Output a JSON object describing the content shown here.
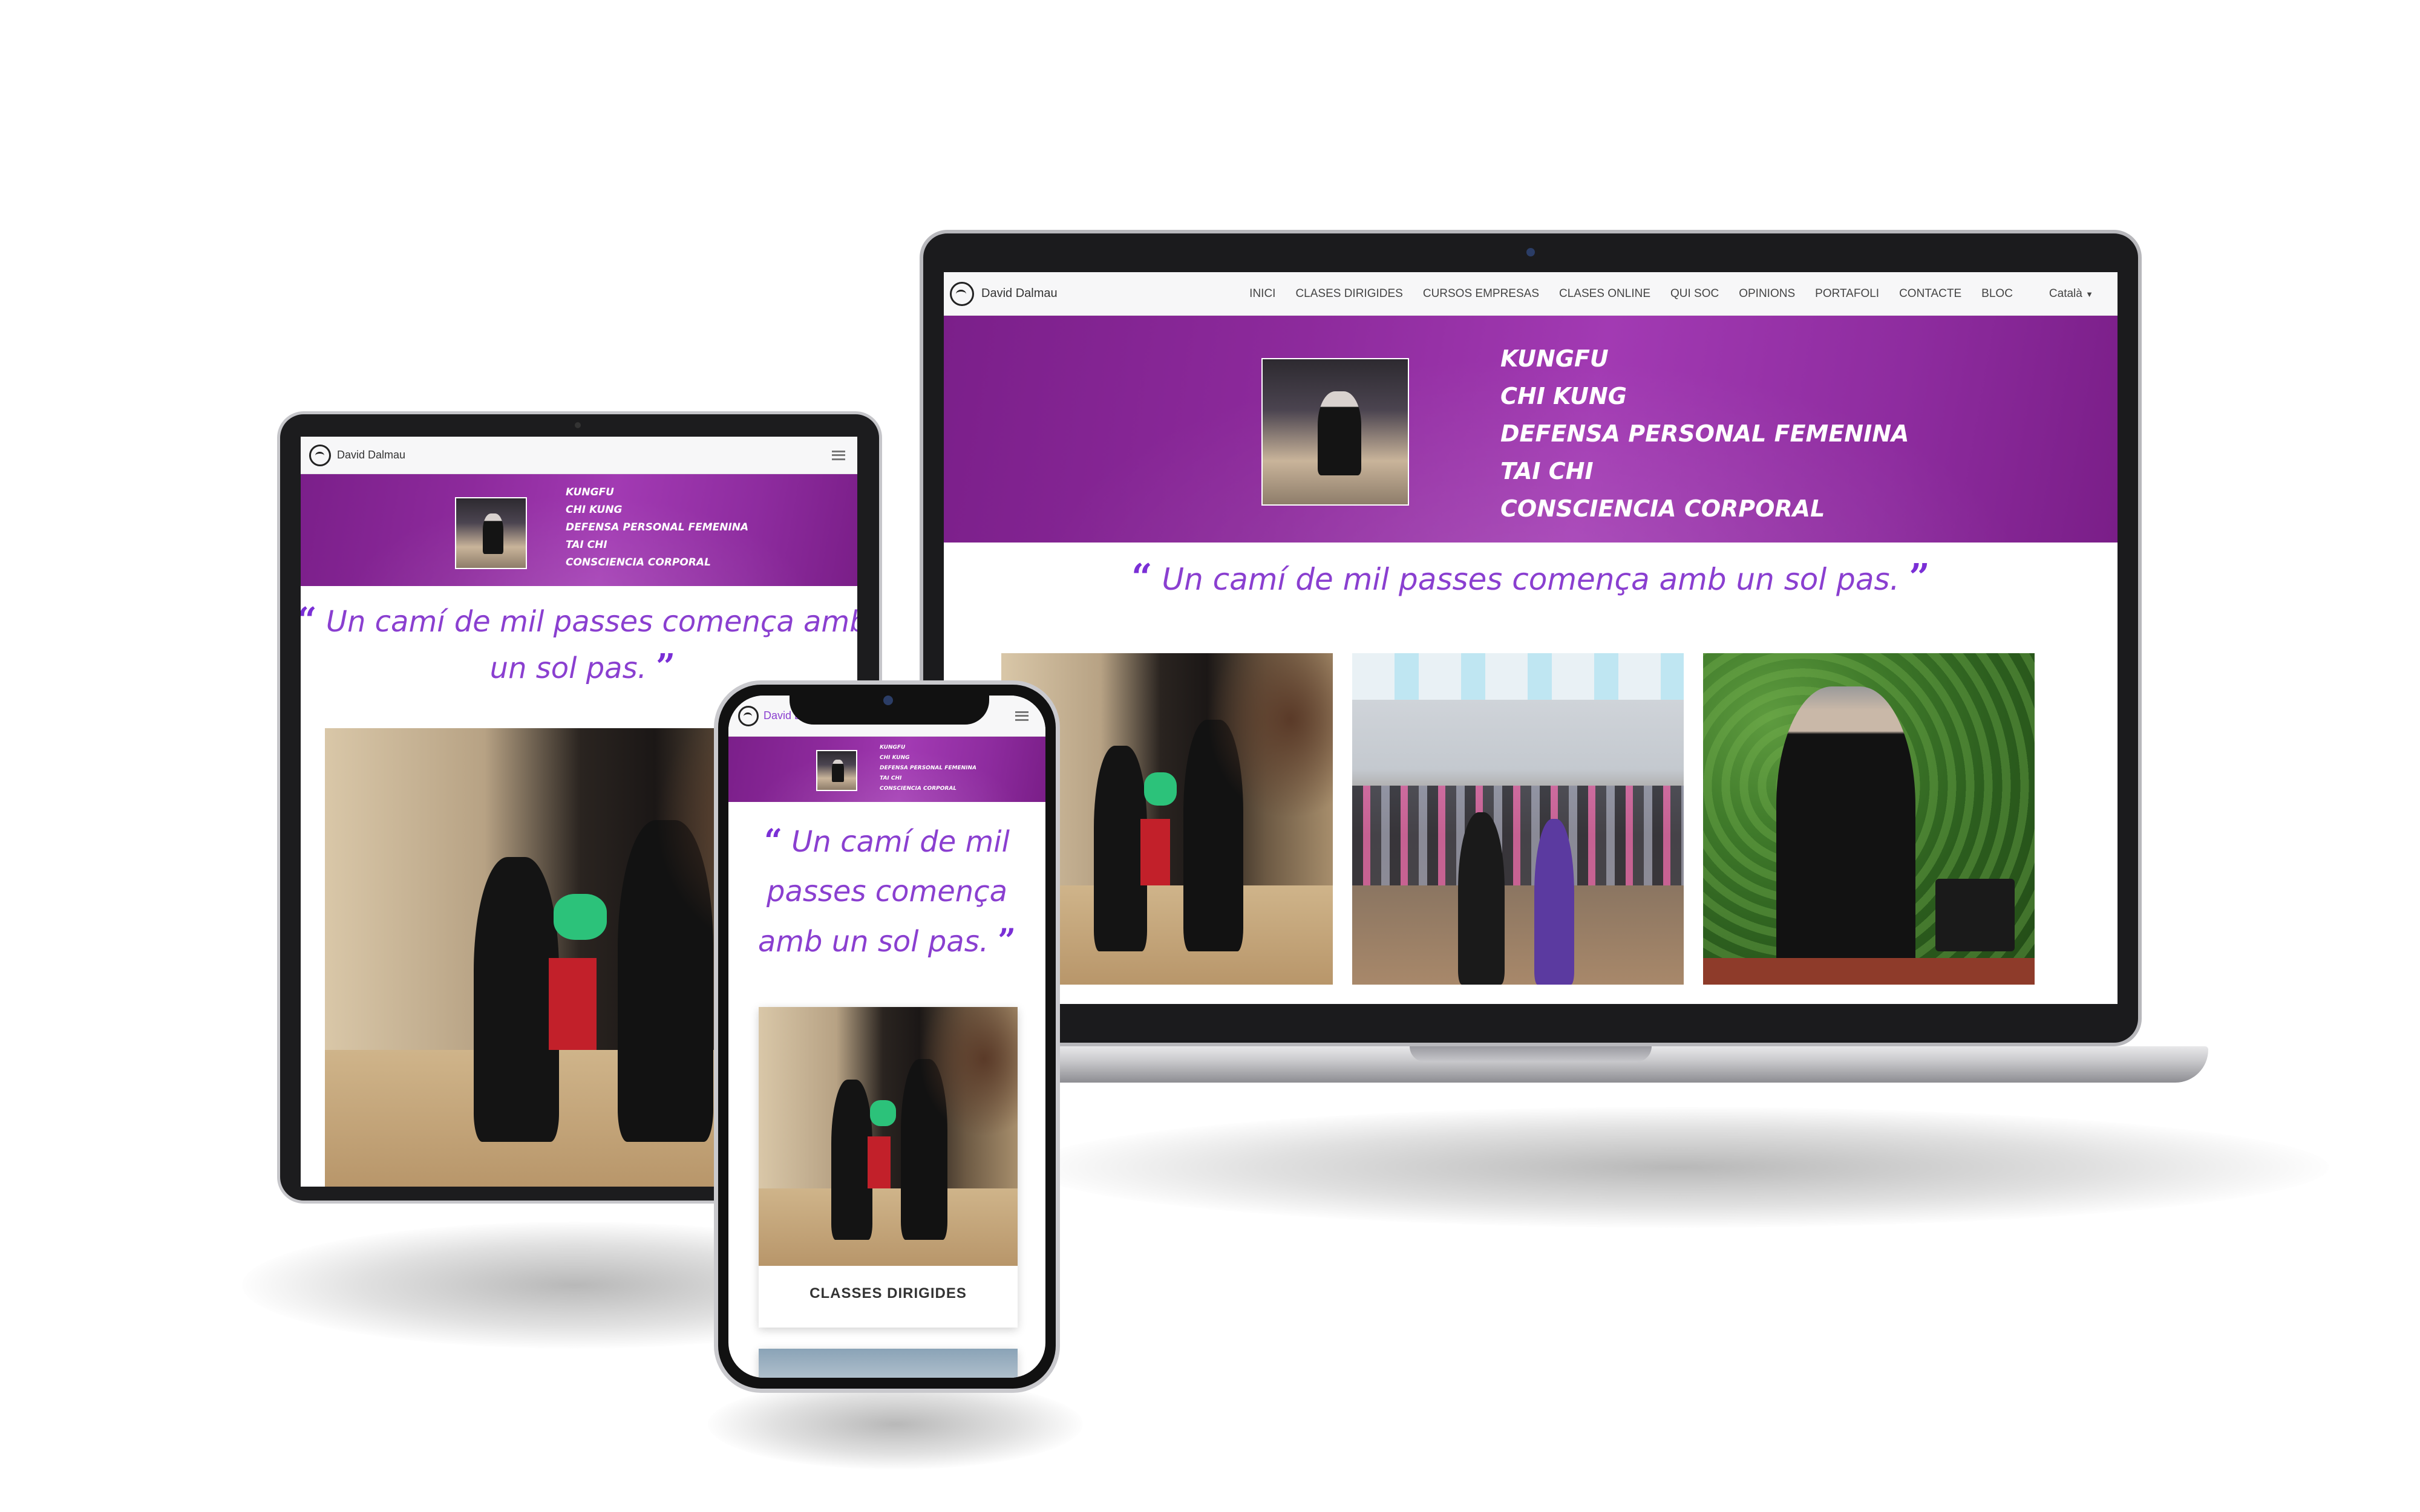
{
  "site": {
    "brand": "David Dalmau",
    "nav": [
      "INICI",
      "CLASES DIRIGIDES",
      "CURSOS EMPRESAS",
      "CLASES ONLINE",
      "QUI SOC",
      "OPINIONS",
      "PORTAFOLI",
      "CONTACTE",
      "BLOC"
    ],
    "language": "Català",
    "hero_items": [
      "KUNGFU",
      "CHI KUNG",
      "DEFENSA PERSONAL FEMENINA",
      "TAI CHI",
      "CONSCIENCIA CORPORAL"
    ],
    "quote": "Un camí de mil passes comença amb un sol pas.",
    "quote_open": "“",
    "quote_close": "”",
    "card_label": "CLASSES DIRIGIDES",
    "colors": {
      "hero": "#8d2a9c",
      "quote": "#8a3fd0",
      "nav_bg": "#f7f7f8"
    }
  }
}
